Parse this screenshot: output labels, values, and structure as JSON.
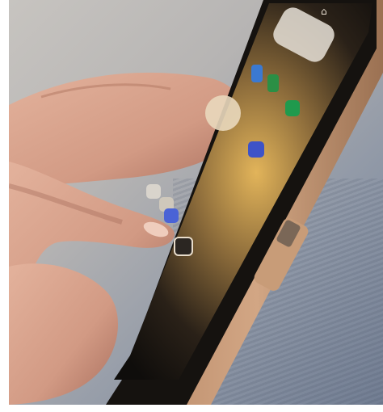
{
  "scene": {
    "description_label": "",
    "device": "smartphone",
    "subject": "hand-touching-phone-screen",
    "colors": {
      "background_light": "#c9c6c2",
      "background_blue": "#6f7b90",
      "skin": "#d9a38c",
      "skin_shadow": "#a9705e",
      "phone_body": "#15120f",
      "case_tan": "#c79a78",
      "screen_glow": "#d9a44a"
    },
    "icons": [
      "lock-icon",
      "app-icon",
      "camera-icon",
      "music-widget"
    ]
  }
}
